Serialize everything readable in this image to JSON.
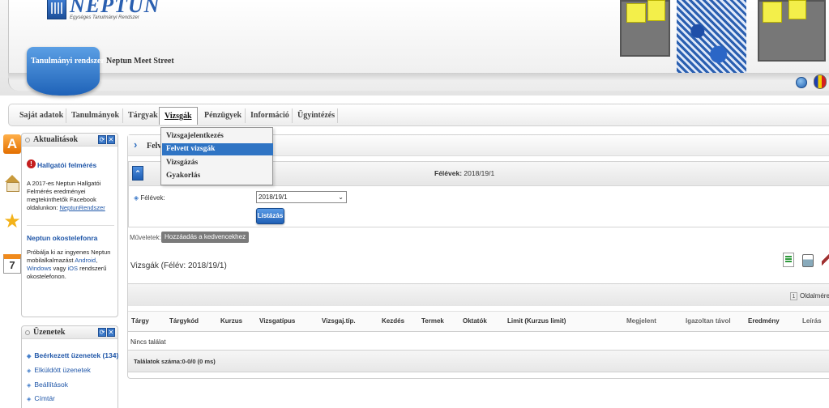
{
  "header": {
    "logo_text": "NEPTUN",
    "logo_subtitle": "Egységes Tanulmányi Rendszer",
    "module_label": "Tanulmányi rendszer",
    "site_label": "Neptun Meet Street"
  },
  "nav": {
    "items": [
      {
        "label": "Saját adatok"
      },
      {
        "label": "Tanulmányok"
      },
      {
        "label": "Tárgyak"
      },
      {
        "label": "Vizsgák"
      },
      {
        "label": "Pénzügyek"
      },
      {
        "label": "Információ"
      },
      {
        "label": "Ügyintézés"
      }
    ],
    "active": "Vizsgák"
  },
  "dropdown": {
    "items": [
      {
        "label": "Vizsgajelentkezés"
      },
      {
        "label": "Felvett vizsgák"
      },
      {
        "label": "Vizsgázás"
      },
      {
        "label": "Gyakorlás"
      }
    ],
    "selected": "Felvett vizsgák"
  },
  "sidebar": {
    "icons": [
      "a-icon",
      "home-icon",
      "star-icon",
      "calendar-icon"
    ],
    "calendar_day": "7",
    "news": {
      "title": "Aktualitások",
      "item1_title": "Hallgatói felmérés",
      "item1_text": "A 2017-es Neptun Hallgatói Felmérés eredményei megtekinthetők Facebook oldalunkon:",
      "item1_link": "NeptunRendszer",
      "item2_title": "Neptun okostelefonra",
      "item2_text_a": "Próbálja ki az ingyenes Neptun mobilalkalmazást",
      "item2_android": "Android",
      "item2_comma": ",",
      "item2_windows": "Windows",
      "item2_or": "vagy",
      "item2_ios": "iOS",
      "item2_text_b": "rendszerű okostelefonon."
    },
    "messages": {
      "title": "Üzenetek",
      "links": [
        {
          "label": "Beérkezett üzenetek (134)"
        },
        {
          "label": "Elküldött üzenetek"
        },
        {
          "label": "Beállítások"
        },
        {
          "label": "Címtár"
        }
      ]
    }
  },
  "content": {
    "title": "Felv",
    "semester_summary_label": "Félévek:",
    "semester_summary_value": "2018/19/1",
    "filter_label": "Félévek:",
    "semester_select": "2018/19/1",
    "list_button": "Listázás",
    "actions_label": "Műveletek:",
    "favorite_button": "Hozzáadás a kedvencekhez",
    "table_title": "Vizsgák (Félév: 2018/19/1)",
    "page_number": "1",
    "page_size_label": "Oldalméret",
    "columns": [
      "Tárgy",
      "Tárgykód",
      "Kurzus",
      "Vizsgatípus",
      "Vizsgaj.típ.",
      "Kezdés",
      "Termek",
      "Oktatók",
      "Limit (Kurzus limit)",
      "Megjelent",
      "Igazoltan távol",
      "Eredmény",
      "Leírás"
    ],
    "no_results": "Nincs találat",
    "results_count": "Találatok száma:0-0/0 (0 ms)"
  }
}
